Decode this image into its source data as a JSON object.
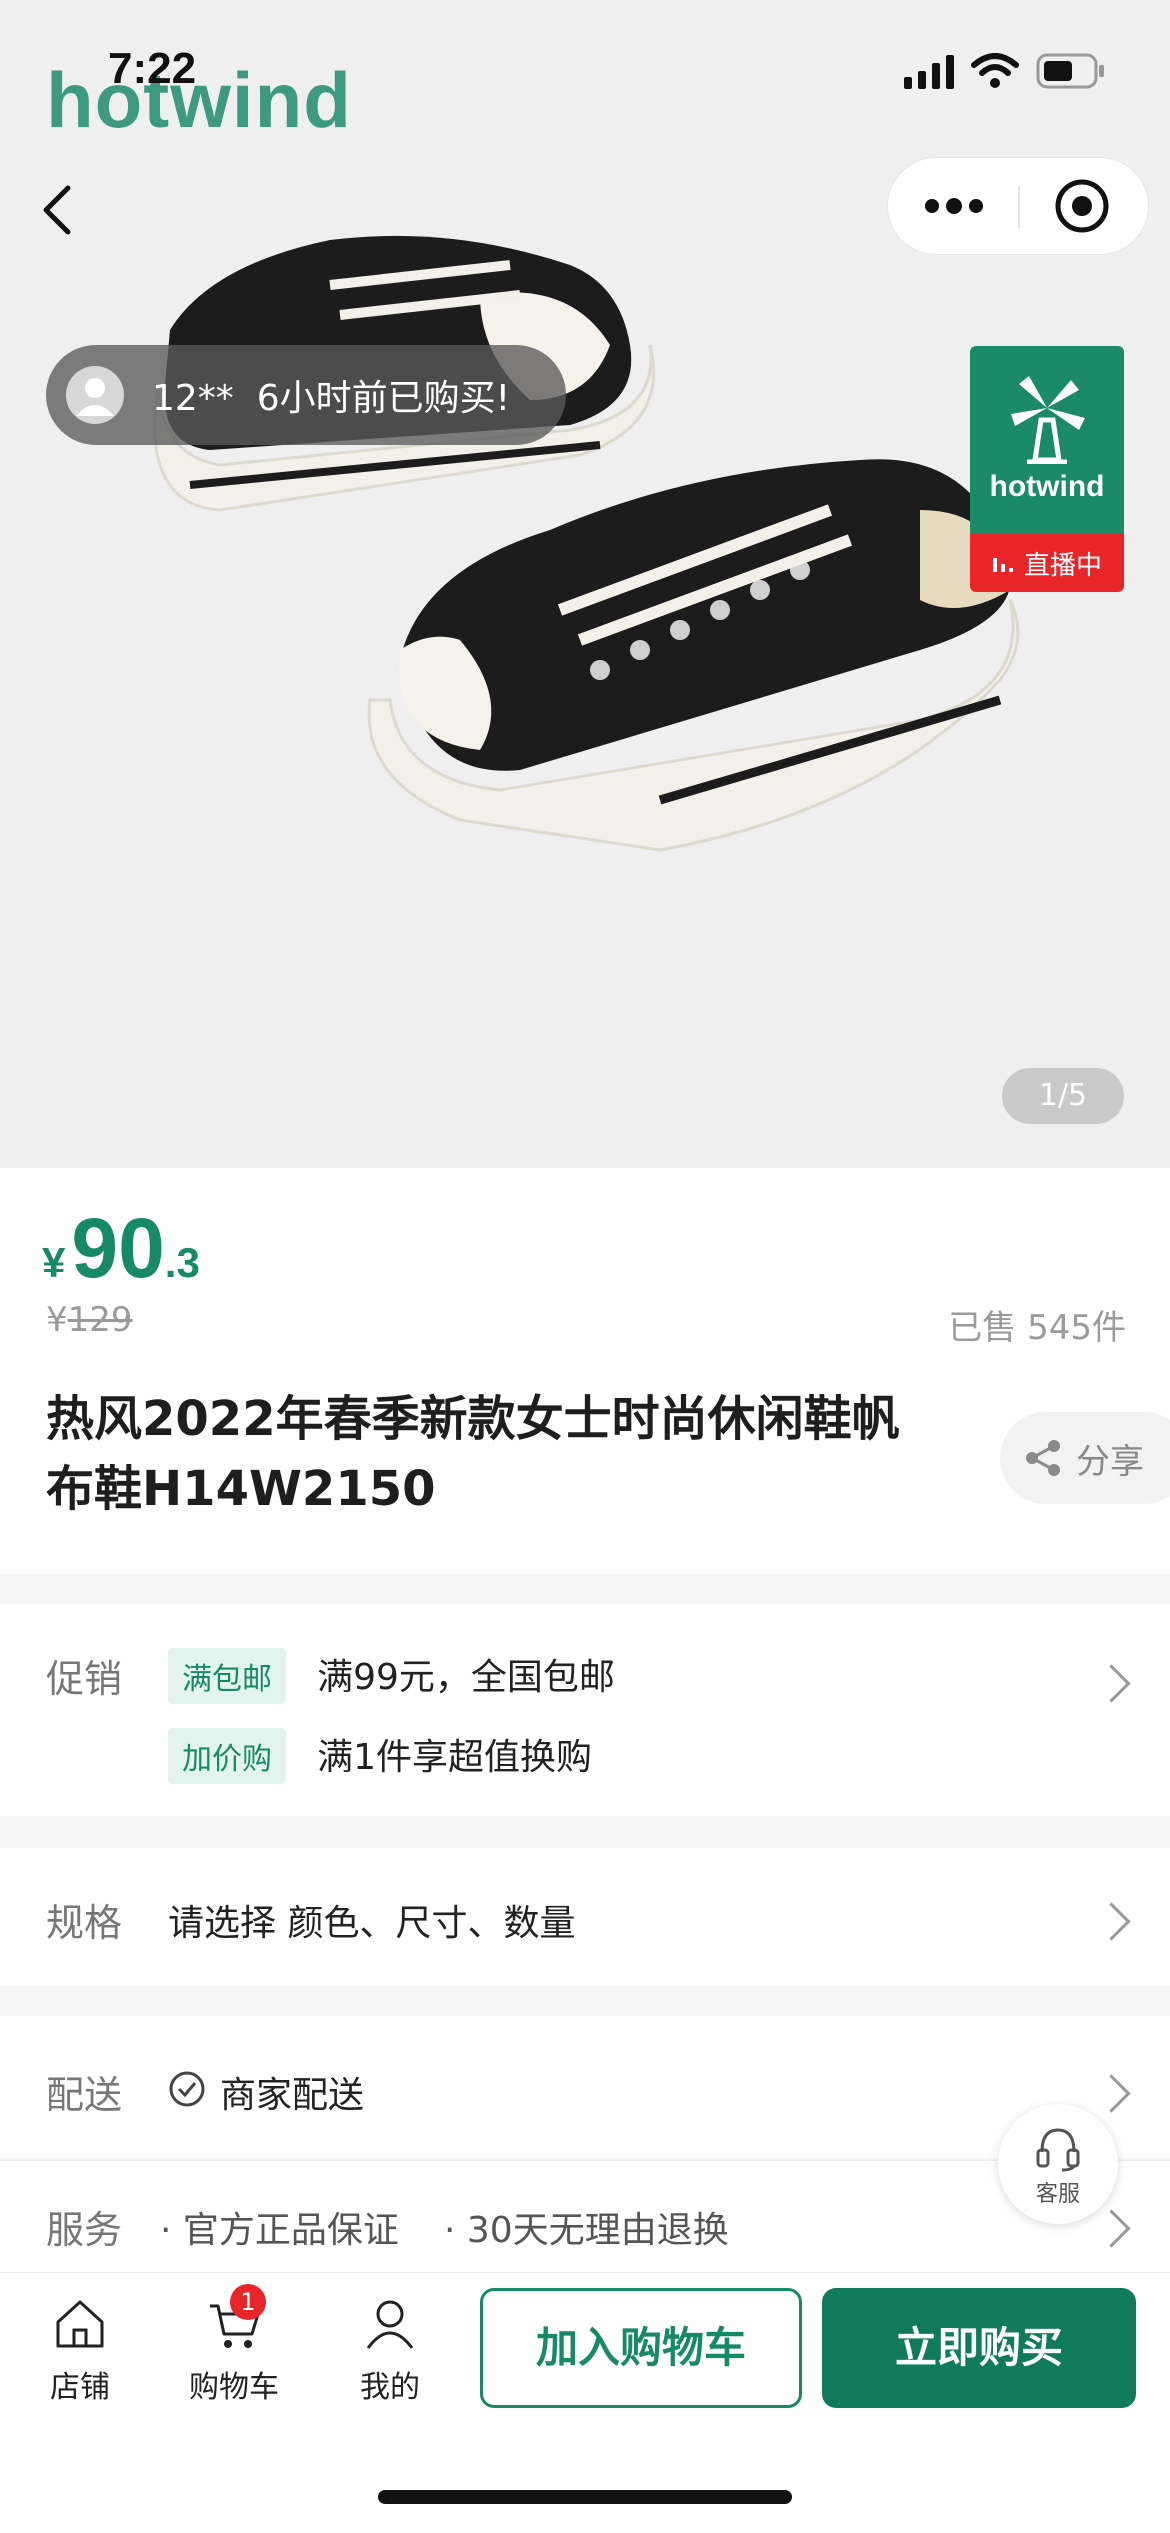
{
  "status_bar": {
    "time": "7:22"
  },
  "hero": {
    "logo_text": "hotwind",
    "recent_purchase": {
      "user": "12**",
      "text": "6小时前已购买!"
    },
    "live_badge": {
      "brand": "hotwind",
      "label": "直播中"
    },
    "pager": "1/5"
  },
  "product": {
    "price_currency": "¥",
    "price_integer": "90",
    "price_decimal": ".3",
    "original_price_currency": "¥",
    "original_price": "129",
    "sold_text": "已售 545件",
    "title": "热风2022年春季新款女士时尚休闲鞋帆布鞋H14W2150",
    "share_label": "分享"
  },
  "promotions": {
    "label": "促销",
    "items": [
      {
        "tag": "满包邮",
        "text": "满99元，全国包邮"
      },
      {
        "tag": "加价购",
        "text": "满1件享超值换购"
      }
    ]
  },
  "spec": {
    "label": "规格",
    "text": "请选择 颜色、尺寸、数量"
  },
  "delivery": {
    "label": "配送",
    "text": "商家配送"
  },
  "service": {
    "label": "服务",
    "items": [
      "· 官方正品保证",
      "· 30天无理由退换"
    ]
  },
  "customer_service": "客服",
  "bottom_nav": {
    "store": "店铺",
    "cart": "购物车",
    "cart_count": "1",
    "me": "我的",
    "add_to_cart": "加入购物车",
    "buy_now": "立即购买"
  },
  "colors": {
    "brand_green": "#168a66",
    "live_red": "#e8262a"
  }
}
